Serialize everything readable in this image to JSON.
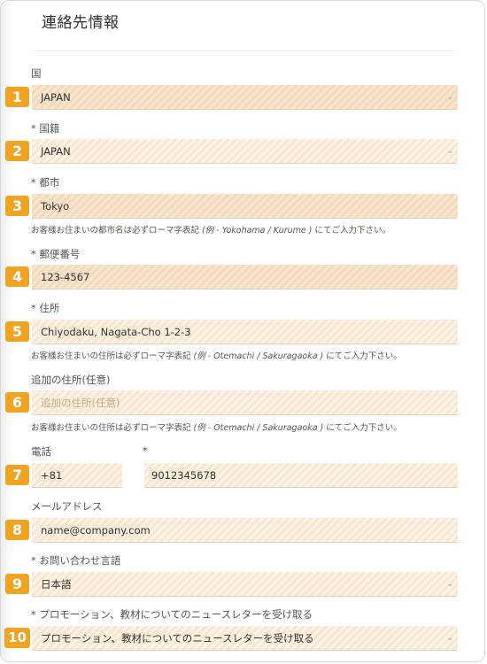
{
  "title": "連絡先情報",
  "fields": {
    "country": {
      "badge": "1",
      "label": "国",
      "value": "JAPAN"
    },
    "nationality": {
      "badge": "2",
      "label": "* 国籍",
      "value": "JAPAN"
    },
    "city": {
      "badge": "3",
      "label": "* 都市",
      "value": "Tokyo",
      "help_pre": "お客様お住まいの都市名は必ずローマ字表記 ",
      "help_ex": "(例 - Yokohama / Kurume )",
      "help_post": " にてご入力下さい。"
    },
    "postal": {
      "badge": "4",
      "label": "* 郵便番号",
      "value": "123-4567"
    },
    "address": {
      "badge": "5",
      "label": "* 住所",
      "value": "Chiyodaku, Nagata-Cho 1-2-3",
      "help_pre": "お客様お住まいの住所は必ずローマ字表記 ",
      "help_ex": "(例 - Otemachi / Sakuragaoka )",
      "help_post": " にてご入力下さい。"
    },
    "address2": {
      "badge": "6",
      "label": "追加の住所(任意)",
      "placeholder": "追加の住所(任意)",
      "help_pre": "お客様お住まいの住所は必ずローマ字表記 ",
      "help_ex": "(例 - Otemachi / Sakuragaoka )",
      "help_post": " にてご入力下さい。"
    },
    "phone": {
      "badge": "7",
      "label": "電話",
      "star": "*",
      "code": "+81",
      "number": "9012345678"
    },
    "email": {
      "badge": "8",
      "label": "メールアドレス",
      "value": "name@company.com"
    },
    "language": {
      "badge": "9",
      "label": "* お問い合わせ言語",
      "value": "日本語"
    },
    "newsletter": {
      "badge": "10",
      "label": "* プロモーション、教材についてのニュースレターを受け取る",
      "value": "プロモーション、教材についてのニュースレターを受け取る"
    }
  },
  "chevron": "⌄"
}
